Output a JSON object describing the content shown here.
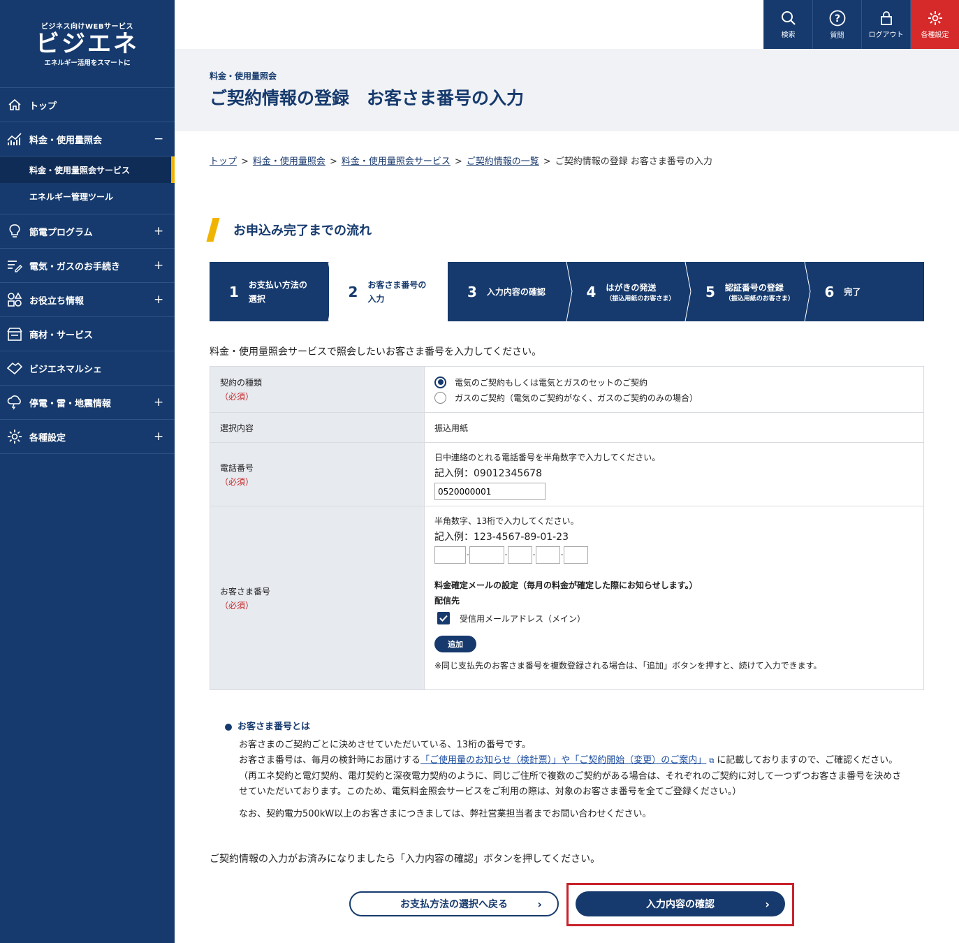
{
  "logo": {
    "small": "ビジネス向けWEBサービス",
    "big": "ビジエネ",
    "tag": "エネルギー活用をスマートに"
  },
  "top_icons": [
    {
      "label": "検索",
      "icon": "search-icon"
    },
    {
      "label": "質問",
      "icon": "question-icon"
    },
    {
      "label": "ログアウト",
      "icon": "lock-icon"
    },
    {
      "label": "各種設定",
      "icon": "gear-icon"
    }
  ],
  "sidebar": {
    "items": [
      {
        "label": "トップ",
        "pm": ""
      },
      {
        "label": "料金・使用量照会",
        "pm": "−"
      },
      {
        "label": "節電プログラム",
        "pm": "+"
      },
      {
        "label": "電気・ガスのお手続き",
        "pm": "+"
      },
      {
        "label": "お役立ち情報",
        "pm": "+"
      },
      {
        "label": "商材・サービス",
        "pm": ""
      },
      {
        "label": "ビジエネマルシェ",
        "pm": ""
      },
      {
        "label": "停電・雷・地震情報",
        "pm": "+"
      },
      {
        "label": "各種設定",
        "pm": "+"
      }
    ],
    "sub": [
      "料金・使用量照会サービス",
      "エネルギー管理ツール"
    ]
  },
  "header": {
    "pre": "料金・使用量照会",
    "title": "ご契約情報の登録　お客さま番号の入力"
  },
  "breadcrumb": [
    "トップ",
    "料金・使用量照会",
    "料金・使用量照会サービス",
    "ご契約情報の一覧",
    "ご契約情報の登録 お客さま番号の入力"
  ],
  "flow_title": "お申込み完了までの流れ",
  "steps": [
    {
      "num": "1",
      "l1": "お支払い方法の",
      "l2": "選択",
      "small": ""
    },
    {
      "num": "2",
      "l1": "お客さま番号の",
      "l2": "入力",
      "small": ""
    },
    {
      "num": "3",
      "l1": "入力内容の確認",
      "l2": "",
      "small": ""
    },
    {
      "num": "4",
      "l1": "はがきの発送",
      "l2": "",
      "small": "（振込用紙のお客さま）"
    },
    {
      "num": "5",
      "l1": "認証番号の登録",
      "l2": "",
      "small": "（振込用紙のお客さま）"
    },
    {
      "num": "6",
      "l1": "完了",
      "l2": "",
      "small": ""
    }
  ],
  "intro": "料金・使用量照会サービスで照会したいお客さま番号を入力してください。",
  "form": {
    "required": "（必須）",
    "contract_type": {
      "label": "契約の種類",
      "opt1": "電気のご契約もしくは電気とガスのセットのご契約",
      "opt2": "ガスのご契約（電気のご契約がなく、ガスのご契約のみの場合）"
    },
    "selection": {
      "label": "選択内容",
      "value": "振込用紙"
    },
    "phone": {
      "label": "電話番号",
      "hint": "日中連絡のとれる電話番号を半角数字で入力してください。",
      "example": "記入例：09012345678",
      "value": "0520000001"
    },
    "customer_no": {
      "label": "お客さま番号",
      "hint": "半角数字、13桁で入力してください。",
      "example": "記入例：123-4567-89-01-23",
      "mail_setting": "料金確定メールの設定（毎月の料金が確定した際にお知らせします。）",
      "dest": "配信先",
      "checkbox": "受信用メールアドレス（メイン）",
      "add": "追加",
      "note": "※同じ支払先のお客さま番号を複数登録される場合は、「追加」ボタンを押すと、続けて入力できます。"
    }
  },
  "info": {
    "title": "お客さま番号とは",
    "p1": "お客さまのご契約ごとに決めさせていただいている、13桁の番号です。",
    "p2a": "お客さま番号は、毎月の検針時にお届けする",
    "p2link": "「ご使用量のお知らせ（検針票）」や「ご契約開始（変更）のご案内」",
    "p2b": "に記載しておりますので、ご確認ください。",
    "p3": "（再エネ契約と電灯契約、電灯契約と深夜電力契約のように、同じご住所で複数のご契約がある場合は、それぞれのご契約に対して一つずつお客さま番号を決めさ",
    "p4": "せていただいております。このため、電気料金照会サービスをご利用の際は、対象のお客さま番号を全てご登録ください。）",
    "p5": "なお、契約電力500kW以上のお客さまにつきましては、弊社営業担当者までお問い合わせください。"
  },
  "outro": "ご契約情報の入力がお済みになりましたら「入力内容の確認」ボタンを押してください。",
  "buttons": {
    "back": "お支払方法の選択へ戻る",
    "confirm": "入力内容の確認"
  }
}
